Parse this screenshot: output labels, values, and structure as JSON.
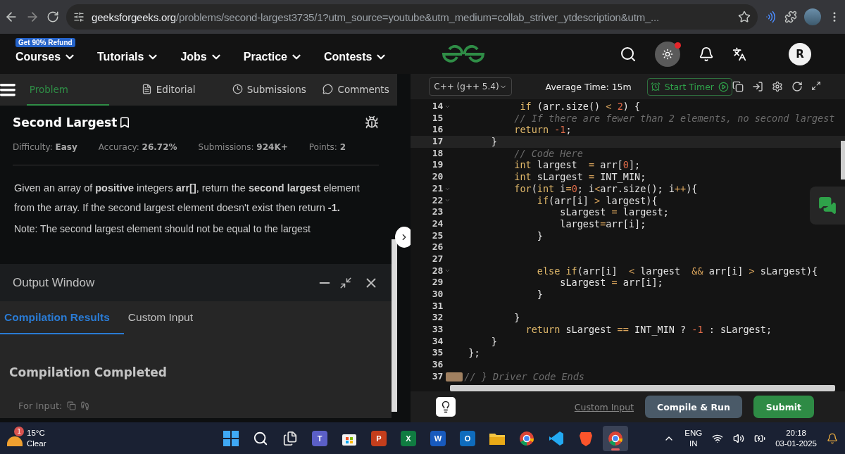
{
  "browser": {
    "url_domain": "geeksforgeeks.org",
    "url_path": "/problems/second-largest3735/1?utm_source=youtube&utm_medium=collab_striver_ytdescription&utm_..."
  },
  "site_nav": {
    "badge": "Get 90% Refund",
    "items": [
      "Courses",
      "Tutorials",
      "Jobs",
      "Practice",
      "Contests"
    ],
    "notification": true,
    "avatar": "R"
  },
  "problem_tabs": [
    {
      "label": "Problem",
      "selected": true
    },
    {
      "label": "Editorial",
      "selected": false
    },
    {
      "label": "Submissions",
      "selected": false
    },
    {
      "label": "Comments",
      "selected": false
    }
  ],
  "problem": {
    "title": "Second Largest",
    "meta": [
      {
        "label": "Difficulty:",
        "value": "Easy"
      },
      {
        "label": "Accuracy:",
        "value": "26.72%"
      },
      {
        "label": "Submissions:",
        "value": "924K+"
      },
      {
        "label": "Points:",
        "value": "2"
      }
    ],
    "description": "Given an array of **positive** integers **arr[]**, return the **second largest** element from the array. If the second largest element doesn't exist then return **-1.**",
    "note": "Note: The second largest element should not be equal to the largest"
  },
  "output_window": {
    "title": "Output Window",
    "tabs": [
      {
        "label": "Compilation Results",
        "selected": true
      },
      {
        "label": "Custom Input",
        "selected": false
      }
    ],
    "status": "Compilation Completed",
    "for_input": "For Input:"
  },
  "editor": {
    "language": "C++ (g++ 5.4)",
    "average_time": "Average Time: 15m",
    "timer": "Start Timer",
    "lines": [
      {
        "number": "14",
        "fold": true,
        "tokens": [
          {
            "kind": "keyword",
            "text": "         if"
          },
          {
            "kind": "plain",
            "text": " (arr.size() "
          },
          {
            "kind": "operator",
            "text": "<"
          },
          {
            "kind": "number",
            "text": " 2"
          },
          {
            "kind": "plain",
            "text": ") {"
          }
        ]
      },
      {
        "number": "15",
        "tokens": [
          {
            "kind": "comment",
            "text": "        // If there are fewer than 2 elements, no second largest"
          }
        ]
      },
      {
        "number": "16",
        "tokens": [
          {
            "kind": "keyword",
            "text": "        return"
          },
          {
            "kind": "number",
            "text": " -1"
          },
          {
            "kind": "plain",
            "text": ";"
          }
        ]
      },
      {
        "number": "17",
        "current": true,
        "tokens": [
          {
            "kind": "plain",
            "text": "    }"
          }
        ]
      },
      {
        "number": "18",
        "tokens": [
          {
            "kind": "comment",
            "text": "        // Code Here"
          }
        ]
      },
      {
        "number": "19",
        "tokens": [
          {
            "kind": "keyword",
            "text": "        int"
          },
          {
            "kind": "plain",
            "text": " largest  "
          },
          {
            "kind": "operator",
            "text": "="
          },
          {
            "kind": "plain",
            "text": " arr["
          },
          {
            "kind": "number",
            "text": "0"
          },
          {
            "kind": "plain",
            "text": "];"
          }
        ]
      },
      {
        "number": "20",
        "tokens": [
          {
            "kind": "keyword",
            "text": "        int"
          },
          {
            "kind": "plain",
            "text": " sLargest "
          },
          {
            "kind": "operator",
            "text": "="
          },
          {
            "kind": "plain",
            "text": " INT_MIN;"
          }
        ]
      },
      {
        "number": "21",
        "fold": true,
        "tokens": [
          {
            "kind": "keyword",
            "text": "        for"
          },
          {
            "kind": "plain",
            "text": "("
          },
          {
            "kind": "keyword",
            "text": "int"
          },
          {
            "kind": "plain",
            "text": " i"
          },
          {
            "kind": "operator",
            "text": "="
          },
          {
            "kind": "number",
            "text": "0"
          },
          {
            "kind": "plain",
            "text": "; i"
          },
          {
            "kind": "operator",
            "text": "<"
          },
          {
            "kind": "plain",
            "text": "arr.size(); i"
          },
          {
            "kind": "operator",
            "text": "++"
          },
          {
            "kind": "plain",
            "text": "){"
          }
        ]
      },
      {
        "number": "22",
        "fold": true,
        "tokens": [
          {
            "kind": "keyword",
            "text": "            if"
          },
          {
            "kind": "plain",
            "text": "(arr[i] "
          },
          {
            "kind": "operator",
            "text": ">"
          },
          {
            "kind": "plain",
            "text": " largest){"
          }
        ]
      },
      {
        "number": "23",
        "tokens": [
          {
            "kind": "plain",
            "text": "                sLargest "
          },
          {
            "kind": "operator",
            "text": "="
          },
          {
            "kind": "plain",
            "text": " largest;"
          }
        ]
      },
      {
        "number": "24",
        "tokens": [
          {
            "kind": "plain",
            "text": "                largest"
          },
          {
            "kind": "operator",
            "text": "="
          },
          {
            "kind": "plain",
            "text": "arr[i];"
          }
        ]
      },
      {
        "number": "25",
        "tokens": [
          {
            "kind": "plain",
            "text": "            }"
          }
        ]
      },
      {
        "number": "26"
      },
      {
        "number": "27"
      },
      {
        "number": "28",
        "fold": true,
        "tokens": [
          {
            "kind": "keyword",
            "text": "            else if"
          },
          {
            "kind": "plain",
            "text": "(arr[i]  "
          },
          {
            "kind": "operator",
            "text": "<"
          },
          {
            "kind": "plain",
            "text": " largest  "
          },
          {
            "kind": "operator",
            "text": "&&"
          },
          {
            "kind": "plain",
            "text": " arr[i] "
          },
          {
            "kind": "operator",
            "text": ">"
          },
          {
            "kind": "plain",
            "text": " sLargest){"
          }
        ]
      },
      {
        "number": "29",
        "tokens": [
          {
            "kind": "plain",
            "text": "                sLargest "
          },
          {
            "kind": "operator",
            "text": "="
          },
          {
            "kind": "plain",
            "text": " arr[i];"
          }
        ]
      },
      {
        "number": "30",
        "tokens": [
          {
            "kind": "plain",
            "text": "            }"
          }
        ]
      },
      {
        "number": "31"
      },
      {
        "number": "32",
        "tokens": [
          {
            "kind": "plain",
            "text": "        }"
          }
        ]
      },
      {
        "number": "33",
        "tokens": [
          {
            "kind": "keyword",
            "text": "          return"
          },
          {
            "kind": "plain",
            "text": " sLargest "
          },
          {
            "kind": "operator",
            "text": "=="
          },
          {
            "kind": "plain",
            "text": " INT_MIN ? "
          },
          {
            "kind": "number",
            "text": "-1"
          },
          {
            "kind": "plain",
            "text": " : sLargest;"
          }
        ]
      },
      {
        "number": "34",
        "tokens": [
          {
            "kind": "plain",
            "text": "    }"
          }
        ]
      },
      {
        "number": "35",
        "tokens": [
          {
            "kind": "plain",
            "text": "};"
          }
        ]
      },
      {
        "number": "36"
      },
      {
        "number": "37",
        "folded": true,
        "tokens": [
          {
            "kind": "comment",
            "text": "// } Driver Code Ends"
          }
        ]
      }
    ],
    "custom_input": "Custom Input",
    "compile": "Compile & Run",
    "submit": "Submit"
  },
  "taskbar": {
    "weather": {
      "badge": "1",
      "temperature": "15°C",
      "condition": "Clear"
    },
    "apps": [
      {
        "kind": "start",
        "selected": false
      },
      {
        "kind": "search",
        "selected": false
      },
      {
        "kind": "taskview",
        "selected": false
      },
      {
        "kind": "chat",
        "letter": "T",
        "selected": false
      },
      {
        "kind": "store",
        "selected": false
      },
      {
        "kind": "slides",
        "letter": "P",
        "selected": false
      },
      {
        "kind": "sheets",
        "letter": "X",
        "selected": false
      },
      {
        "kind": "docs",
        "letter": "W",
        "selected": false
      },
      {
        "kind": "mail",
        "letter": "O",
        "selected": false
      },
      {
        "kind": "folder",
        "selected": false
      },
      {
        "kind": "browser",
        "selected": false
      },
      {
        "kind": "editor",
        "selected": false
      },
      {
        "kind": "shield",
        "selected": false
      },
      {
        "kind": "browser",
        "selected": true
      }
    ],
    "language": [
      "ENG",
      "IN"
    ],
    "time": "20:18",
    "date": "03-01-2025"
  }
}
